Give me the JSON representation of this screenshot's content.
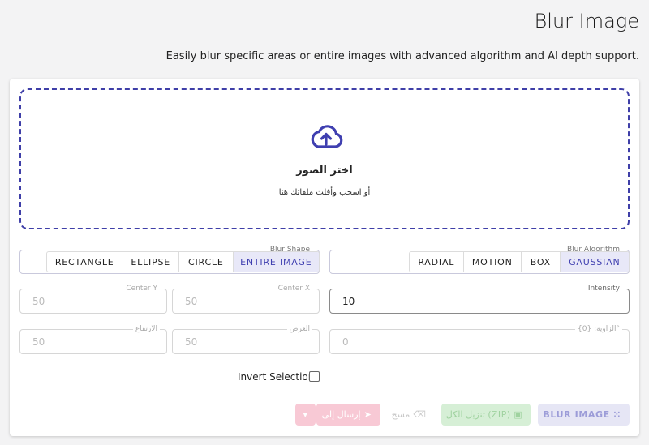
{
  "header": {
    "title": "Blur Image",
    "subtitle": "Easily blur specific areas or entire images with advanced algorithm and AI depth support."
  },
  "dropzone": {
    "title": "اختر الصور",
    "hint": "أو اسحب وأفلت ملفاتك هنا",
    "icon": "cloud-upload-icon"
  },
  "blur_shape": {
    "label": "Blur Shape",
    "options": [
      "RECTANGLE",
      "ELLIPSE",
      "CIRCLE",
      "ENTIRE IMAGE"
    ],
    "selected": "ENTIRE IMAGE"
  },
  "blur_algorithm": {
    "label": "Blur Algorithm",
    "options": [
      "RADIAL",
      "MOTION",
      "BOX",
      "GAUSSIAN"
    ],
    "selected": "GAUSSIAN"
  },
  "fields": {
    "intensity": {
      "label": "Intensity",
      "value": "10"
    },
    "center_x": {
      "label": "Center X",
      "value": "50"
    },
    "center_y": {
      "label": "Center Y",
      "value": "50"
    },
    "angle": {
      "label": "الزاوية: {0}°",
      "value": "0"
    },
    "width": {
      "label": "العرض",
      "value": "50"
    },
    "height": {
      "label": "الارتفاع",
      "value": "50"
    }
  },
  "invert_selection": {
    "label": "Invert Selection",
    "checked": false
  },
  "actions": {
    "blur": "BLUR IMAGE",
    "download_zip": "تنزيل الكل (ZIP)",
    "clear": "مسح",
    "send_to": "إرسال إلى"
  },
  "colors": {
    "accent": "#3f3fb0",
    "dashed_border": "#3f3fa8",
    "selected_bg": "#e8e8f8",
    "zip_bg": "#d6efd6",
    "send_bg": "#f8c9d5"
  }
}
